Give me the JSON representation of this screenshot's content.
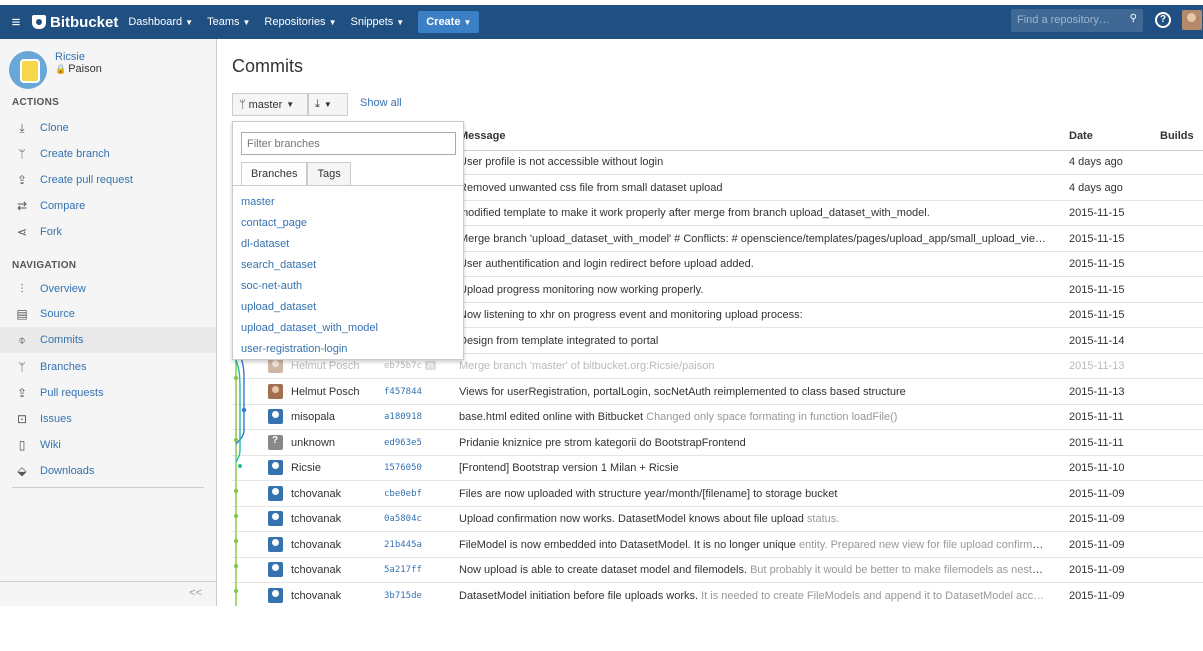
{
  "nav": {
    "brand": "Bitbucket",
    "menus": [
      "Dashboard",
      "Teams",
      "Repositories",
      "Snippets"
    ],
    "create": "Create",
    "search_placeholder": "Find a repository…",
    "help": "?"
  },
  "repo": {
    "owner": "Ricsie",
    "name": "Paison"
  },
  "sidebar": {
    "actions_heading": "ACTIONS",
    "actions": [
      "Clone",
      "Create branch",
      "Create pull request",
      "Compare",
      "Fork"
    ],
    "navigation_heading": "NAVIGATION",
    "navigation": [
      "Overview",
      "Source",
      "Commits",
      "Branches",
      "Pull requests",
      "Issues",
      "Wiki",
      "Downloads"
    ],
    "active": "Commits",
    "collapse": "<<"
  },
  "main": {
    "title": "Commits",
    "branch_button": "master",
    "show_all": "Show all",
    "columns": {
      "message": "Message",
      "date": "Date",
      "builds": "Builds"
    }
  },
  "dropdown": {
    "filter_placeholder": "Filter branches",
    "tabs": [
      "Branches",
      "Tags"
    ],
    "branches": [
      "master",
      "contact_page",
      "dl-dataset",
      "search_dataset",
      "soc-net-auth",
      "upload_dataset",
      "upload_dataset_with_model",
      "user-registration-login"
    ]
  },
  "commits": [
    {
      "message": "User profile is not accessible without login",
      "date": "4 days ago"
    },
    {
      "message": "Removed unwanted css file from small dataset upload",
      "date": "4 days ago"
    },
    {
      "message": "modified template to make it work properly after merge from branch upload_dataset_with_model.",
      "date": "2015-11-15"
    },
    {
      "message": "Merge branch 'upload_dataset_with_model' # Conflicts: # openscience/templates/pages/upload_app/small_upload_vie…",
      "date": "2015-11-15"
    },
    {
      "message": "User authentification and login redirect before upload added.",
      "date": "2015-11-15"
    },
    {
      "message": "Upload progress monitoring now working properly.",
      "date": "2015-11-15"
    },
    {
      "message": "Now listening to xhr on progress event and monitoring upload process:",
      "date": "2015-11-15"
    },
    {
      "message": "Design from template integrated to portal",
      "date": "2015-11-14"
    },
    {
      "author": "Helmut Posch",
      "hash": "eb75b7c",
      "badge": "M",
      "message": "Merge branch 'master' of bitbucket.org:Ricsie/paison",
      "date": "2015-11-13"
    },
    {
      "author": "Helmut Posch",
      "hash": "f457844",
      "message": "Views for userRegistration, portalLogin, socNetAuth reimplemented to class based structure",
      "date": "2015-11-13"
    },
    {
      "author": "misopala",
      "hash": "a180918",
      "message": "base.html edited online with Bitbucket",
      "message_muted": "Changed only space formating in function loadFile()",
      "date": "2015-11-11"
    },
    {
      "author": "unknown",
      "hash": "ed963e5",
      "message": "Pridanie kniznice pre strom kategorii do BootstrapFrontend",
      "date": "2015-11-11"
    },
    {
      "author": "Ricsie",
      "hash": "1576050",
      "message": "[Frontend] Bootstrap version 1 Milan + Ricsie",
      "date": "2015-11-10"
    },
    {
      "author": "tchovanak",
      "hash": "cbe0ebf",
      "message": "Files are now uploaded with structure year/month/[filename] to storage bucket",
      "date": "2015-11-09"
    },
    {
      "author": "tchovanak",
      "hash": "0a5804c",
      "message": "Upload confirmation now works. DatasetModel knows about file upload",
      "message_muted": "status.",
      "date": "2015-11-09"
    },
    {
      "author": "tchovanak",
      "hash": "21b445a",
      "message": "FileModel is now embedded into DatasetModel. It is no longer unique",
      "message_muted": "entity. Prepared new view for file upload confirma…",
      "date": "2015-11-09"
    },
    {
      "author": "tchovanak",
      "hash": "5a217ff",
      "message": "Now upload is able to create dataset model and filemodels.",
      "message_muted": "But probably it would be better to make filemodels as neste…",
      "date": "2015-11-09"
    },
    {
      "author": "tchovanak",
      "hash": "3b715de",
      "message": "DatasetModel initiation before file uploads works.",
      "message_muted": "It is needed to create FileModels and append it to DatasetModel acc…",
      "date": "2015-11-09"
    }
  ]
}
